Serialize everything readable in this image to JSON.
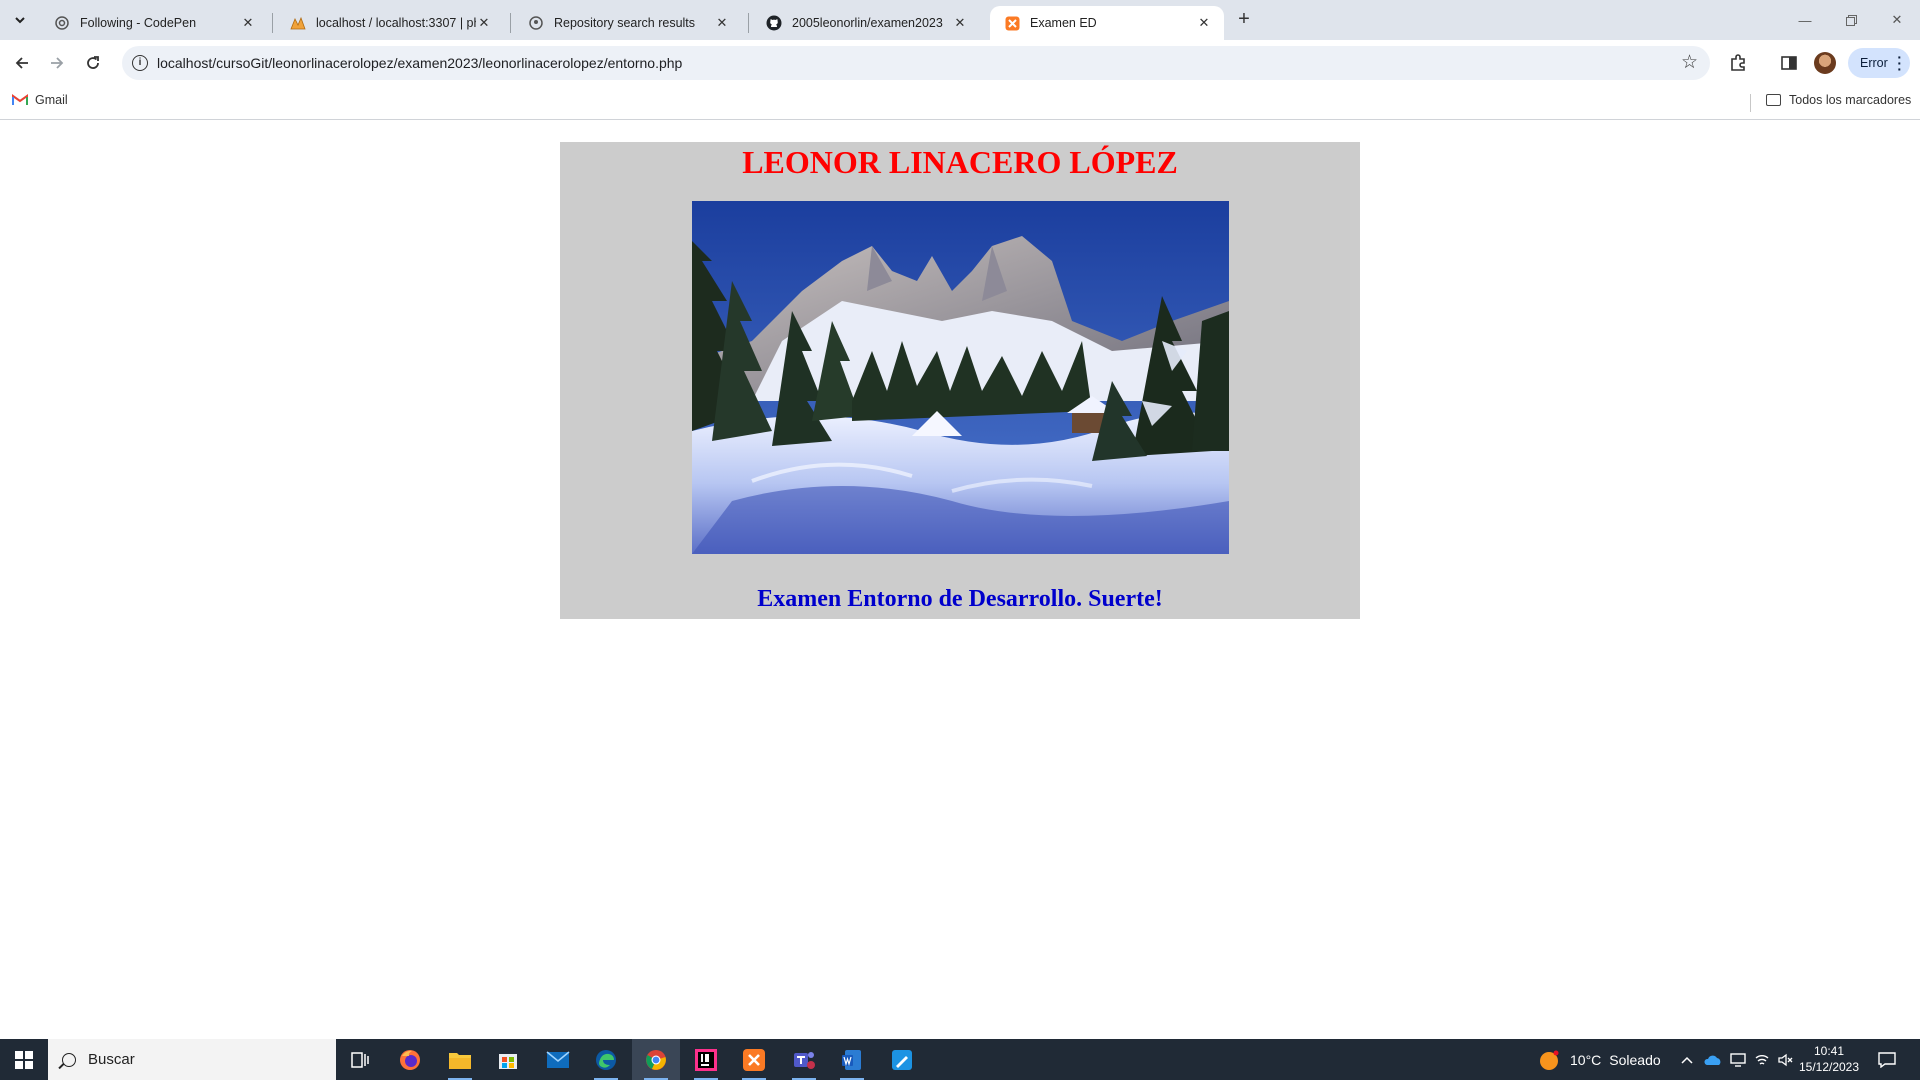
{
  "browser": {
    "tabs": [
      {
        "title": "Following - CodePen",
        "icon": "codepen-icon",
        "active": false
      },
      {
        "title": "localhost / localhost:3307 | php",
        "icon": "phpmyadmin-icon",
        "active": false
      },
      {
        "title": "Repository search results",
        "icon": "github-icon",
        "active": false
      },
      {
        "title": "2005leonorlin/examen2023",
        "icon": "github-icon",
        "active": false
      },
      {
        "title": "Examen ED",
        "icon": "xampp-icon",
        "active": true
      }
    ],
    "url": "localhost/cursoGit/leonorlinacerolopez/examen2023/leonorlinacerolopez/entorno.php",
    "profile_status": "Error",
    "bookmarks": {
      "gmail": "Gmail",
      "all_bookmarks": "Todos los marcadores"
    }
  },
  "page": {
    "title": "LEONOR LINACERO LÓPEZ",
    "image_alt": "",
    "subtitle": "Examen Entorno de Desarrollo. Suerte!",
    "colors": {
      "panel": "#cccccc",
      "title": "#ff0000",
      "subtitle": "#0000cc"
    }
  },
  "taskbar": {
    "search_placeholder": "Buscar",
    "apps": [
      "task-view-icon",
      "firefox-icon",
      "file-explorer-icon",
      "store-icon",
      "mail-icon",
      "edge-icon",
      "chrome-icon",
      "intellij-icon",
      "xampp-icon",
      "teams-icon",
      "word-icon",
      "paint-icon"
    ],
    "weather": {
      "temp": "10°C",
      "condition": "Soleado"
    },
    "time": "10:41",
    "date": "15/12/2023"
  }
}
